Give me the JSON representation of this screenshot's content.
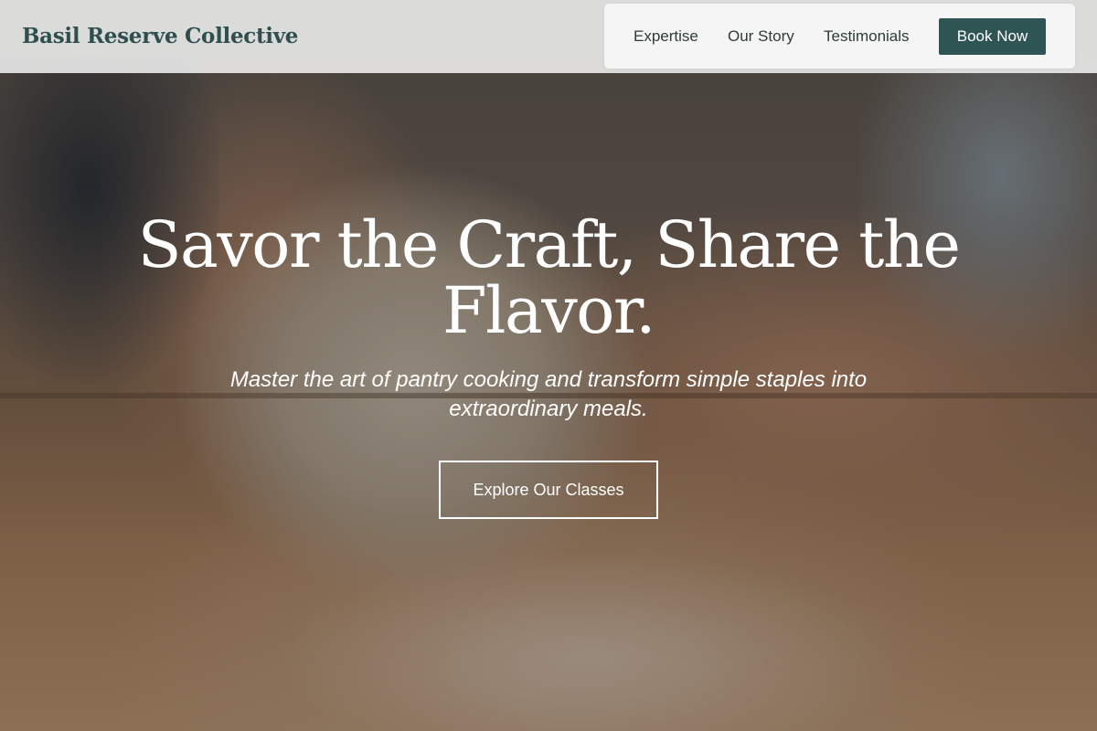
{
  "header": {
    "brand": "Basil Reserve Collective",
    "nav": {
      "expertise": "Expertise",
      "our_story": "Our Story",
      "testimonials": "Testimonials",
      "book_now": "Book Now"
    }
  },
  "hero": {
    "title": "Savor the Craft, Share the Flavor.",
    "subtitle": "Master the art of pantry cooking and transform simple staples into extraordinary meals.",
    "cta": "Explore Our Classes"
  },
  "colors": {
    "brand_text": "#2f4f4f",
    "book_button_bg": "#2f5454",
    "header_bg": "#f0f0f0",
    "hero_text": "#ffffff"
  }
}
